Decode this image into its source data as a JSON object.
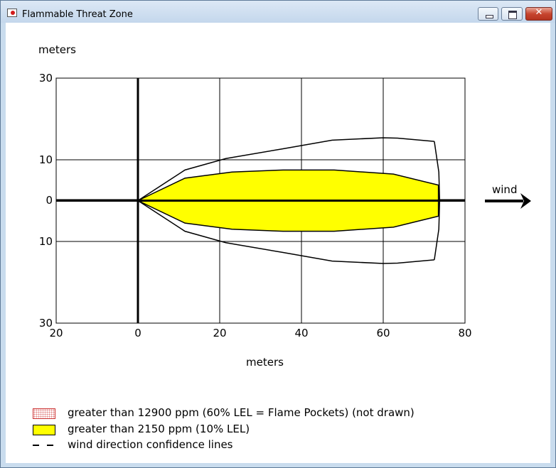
{
  "window": {
    "title": "Flammable Threat Zone",
    "icon": "app-icon",
    "controls": [
      "minimize-icon",
      "maximize-icon",
      "close-icon"
    ],
    "close_glyph": "✕"
  },
  "plot": {
    "ylabel": "meters",
    "xlabel": "meters",
    "wind_label": "wind",
    "x_tick_labels": [
      "20",
      "0",
      "20",
      "40",
      "60",
      "80"
    ],
    "y_tick_labels": [
      "30",
      "10",
      "0",
      "10",
      "30"
    ]
  },
  "chart_data": {
    "type": "area",
    "xlim": [
      -20,
      80
    ],
    "ylim": [
      -30,
      30
    ],
    "x_ticks": [
      -20,
      0,
      20,
      40,
      60,
      80
    ],
    "y_ticks": [
      30,
      10,
      0,
      -10,
      -30
    ],
    "grid": true,
    "threat_zone_upper": {
      "x": [
        0,
        11.5,
        23,
        35.5,
        48,
        62.5,
        73.5
      ],
      "y": [
        0,
        5.5,
        7,
        7.5,
        7.5,
        6.5,
        3.8
      ]
    },
    "threat_zone_lower": {
      "x": [
        0,
        11.5,
        23,
        35.5,
        48,
        62.5,
        73.5
      ],
      "y": [
        0,
        -5.5,
        -7,
        -7.5,
        -7.5,
        -6.5,
        -3.8
      ]
    },
    "confidence_upper": {
      "x": [
        0,
        11.5,
        21.5,
        35.5,
        47.5,
        60,
        63.5,
        72.5
      ],
      "y": [
        0,
        7.5,
        10.3,
        12.7,
        14.8,
        15.4,
        15.3,
        14.5
      ]
    },
    "confidence_lower": {
      "x": [
        0,
        11.5,
        21.5,
        35.5,
        47.5,
        60,
        63.5,
        72.5
      ],
      "y": [
        0,
        -7.5,
        -10.3,
        -12.7,
        -14.8,
        -15.4,
        -15.3,
        -14.5
      ]
    },
    "confidence_end_arc": {
      "x": [
        72.5,
        73.6,
        73.8,
        73.6,
        72.5
      ],
      "y": [
        14.5,
        7,
        0,
        -7,
        -14.5
      ]
    }
  },
  "legend": [
    {
      "swatch": "dotted",
      "color": "#e08080",
      "label": "greater than 12900 ppm (60% LEL = Flame Pockets) (not drawn)"
    },
    {
      "swatch": "yellow",
      "color": "#ffff00",
      "label": "greater than 2150 ppm (10% LEL)"
    },
    {
      "swatch": "dash",
      "color": "#000000",
      "label": "wind direction confidence lines"
    }
  ],
  "colors": {
    "threat_fill": "#ffff00",
    "lines": "#000000",
    "titlebar": "#c9dcee"
  }
}
